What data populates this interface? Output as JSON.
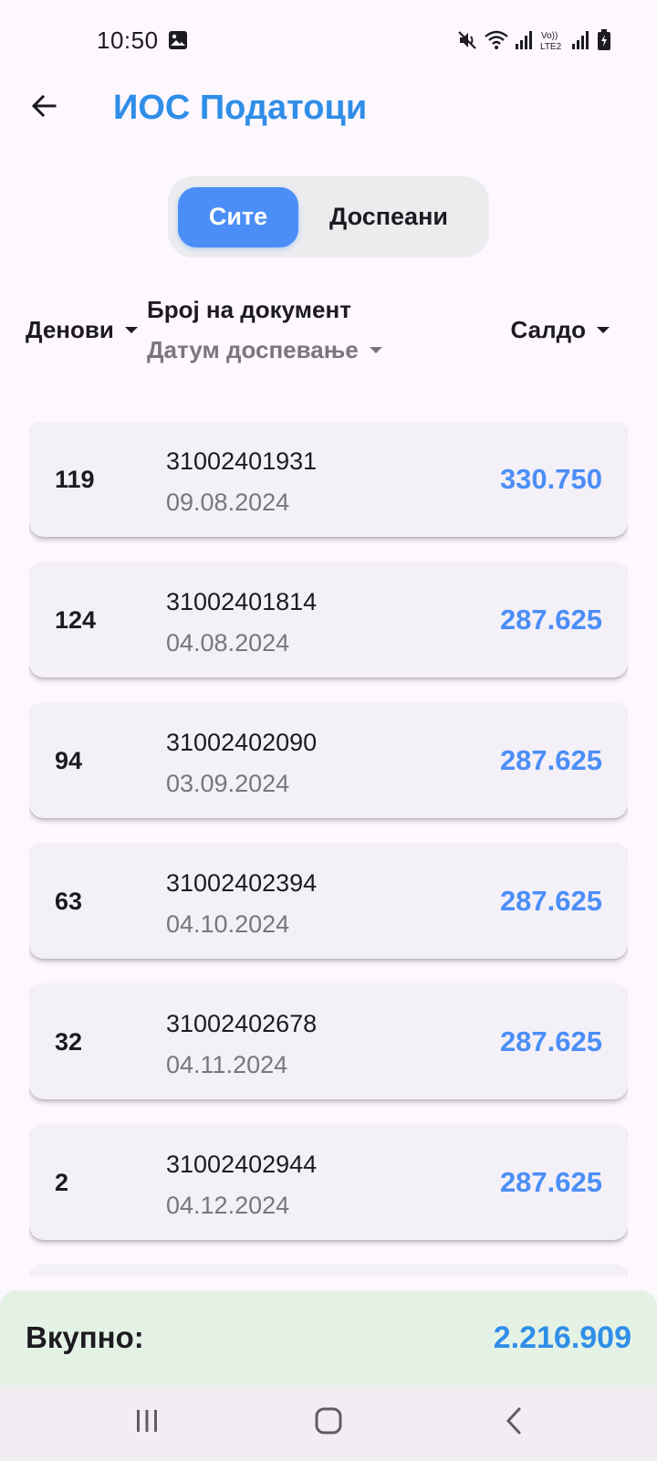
{
  "status_bar": {
    "time": "10:50",
    "icons": [
      "gallery-icon",
      "mute-icon",
      "wifi-icon",
      "signal-icon",
      "volte-icon",
      "signal-icon",
      "battery-icon"
    ],
    "volte_label": "Vo))\nLTE2"
  },
  "app_bar": {
    "title": "ИОС Податоци"
  },
  "filter": {
    "all_label": "Сите",
    "due_label": "Доспеани",
    "selected": "all"
  },
  "columns": {
    "days": "Денови",
    "document": "Број на документ",
    "due_date": "Датум доспевање",
    "balance": "Салдо"
  },
  "items": [
    {
      "days": "119",
      "document": "31002401931",
      "date": "09.08.2024",
      "amount": "330.750"
    },
    {
      "days": "124",
      "document": "31002401814",
      "date": "04.08.2024",
      "amount": "287.625"
    },
    {
      "days": "94",
      "document": "31002402090",
      "date": "03.09.2024",
      "amount": "287.625"
    },
    {
      "days": "63",
      "document": "31002402394",
      "date": "04.10.2024",
      "amount": "287.625"
    },
    {
      "days": "32",
      "document": "31002402678",
      "date": "04.11.2024",
      "amount": "287.625"
    },
    {
      "days": "2",
      "document": "31002402944",
      "date": "04.12.2024",
      "amount": "287.625"
    }
  ],
  "total": {
    "label": "Вкупно:",
    "value": "2.216.909"
  },
  "colors": {
    "accent": "#4b8ef7",
    "title": "#2f8ee8",
    "background": "#fdf7fe",
    "card": "#f4f0f7",
    "total_bar": "#e4f2e6"
  }
}
